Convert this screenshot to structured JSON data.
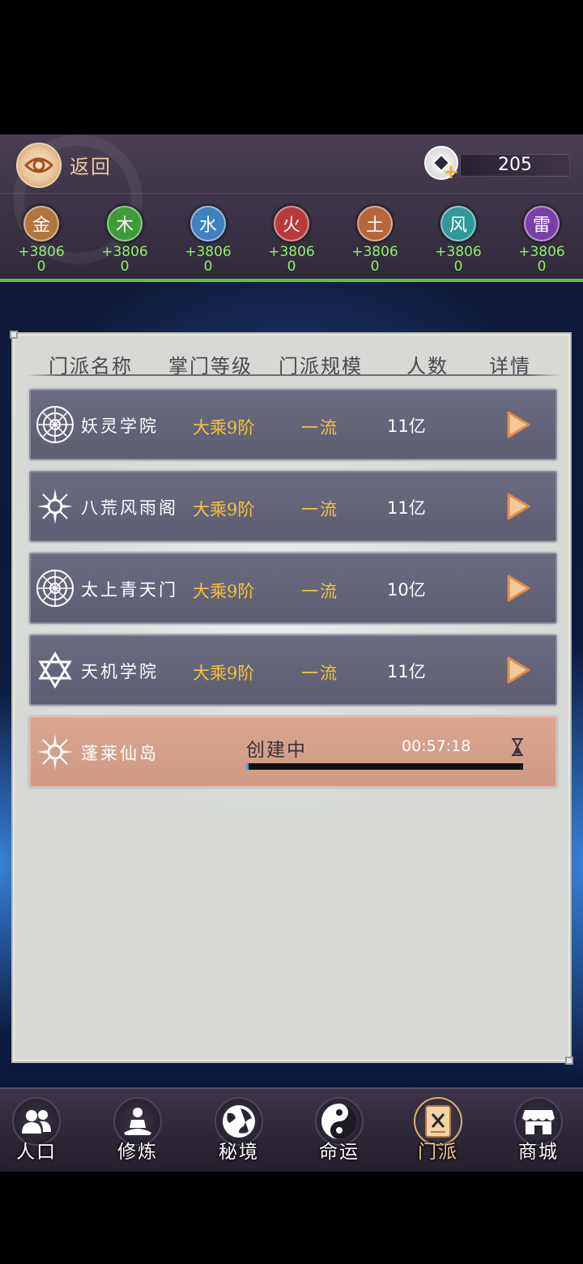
{
  "header": {
    "back_label": "返回",
    "currency_value": "205",
    "elements": [
      {
        "label": "金",
        "gain": "+3806",
        "sub": "0",
        "color": "#b0763e"
      },
      {
        "label": "木",
        "gain": "+3806",
        "sub": "0",
        "color": "#3f9a3a"
      },
      {
        "label": "水",
        "gain": "+3806",
        "sub": "0",
        "color": "#3f82c2"
      },
      {
        "label": "火",
        "gain": "+3806",
        "sub": "0",
        "color": "#b83a3a"
      },
      {
        "label": "土",
        "gain": "+3806",
        "sub": "0",
        "color": "#b8673a"
      },
      {
        "label": "风",
        "gain": "+3806",
        "sub": "0",
        "color": "#2f9a9a"
      },
      {
        "label": "雷",
        "gain": "+3806",
        "sub": "0",
        "color": "#7a3fa8"
      }
    ]
  },
  "table": {
    "headers": [
      "门派名称",
      "掌门等级",
      "门派规模",
      "人数",
      "详情"
    ],
    "rows": [
      {
        "name": "妖灵学院",
        "level": "大乘9阶",
        "scale": "一流",
        "count": "11亿",
        "icon": "bagua-wheel-icon"
      },
      {
        "name": "八荒风雨阁",
        "level": "大乘9阶",
        "scale": "一流",
        "count": "11亿",
        "icon": "sun-burst-icon"
      },
      {
        "name": "太上青天门",
        "level": "大乘9阶",
        "scale": "一流",
        "count": "10亿",
        "icon": "bagua-wheel-icon"
      },
      {
        "name": "天机学院",
        "level": "大乘9阶",
        "scale": "一流",
        "count": "11亿",
        "icon": "hexagram-icon"
      }
    ],
    "building": {
      "name": "蓬莱仙岛",
      "status": "创建中",
      "timer": "00:57:18",
      "progress": 0.01,
      "icon": "sun-burst-icon"
    }
  },
  "nav": [
    {
      "label": "人口",
      "icon": "people-icon",
      "active": false
    },
    {
      "label": "修炼",
      "icon": "meditation-icon",
      "active": false
    },
    {
      "label": "秘境",
      "icon": "globe-icon",
      "active": false
    },
    {
      "label": "命运",
      "icon": "yin-yang-icon",
      "active": false
    },
    {
      "label": "门派",
      "icon": "sect-book-icon",
      "active": true
    },
    {
      "label": "商城",
      "icon": "shop-icon",
      "active": false
    }
  ],
  "colors": {
    "accent_green": "#56c73e",
    "gold_text": "#f2c43a",
    "building_row": "#d9a58e"
  }
}
